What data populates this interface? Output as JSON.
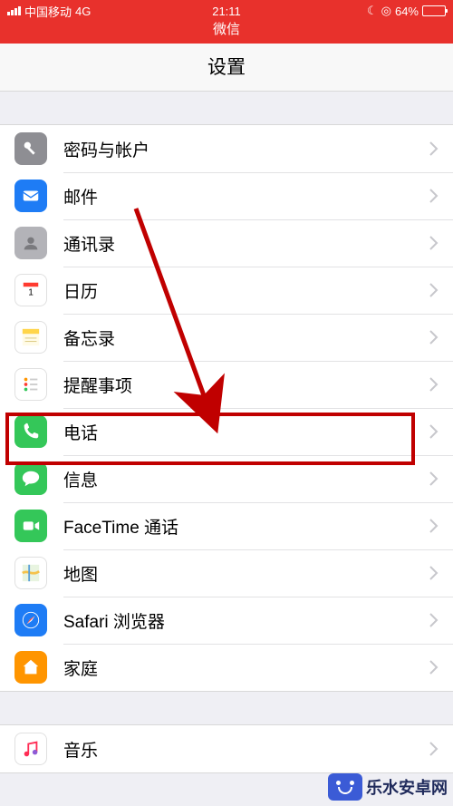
{
  "status": {
    "carrier": "中国移动",
    "network": "4G",
    "time": "21:11",
    "battery": "64%",
    "moon": "☾",
    "alarm": "◎"
  },
  "nav": {
    "subtitle": "微信"
  },
  "page": {
    "title": "设置"
  },
  "group1": [
    {
      "id": "password",
      "label": "密码与帐户"
    },
    {
      "id": "mail",
      "label": "邮件"
    },
    {
      "id": "contacts",
      "label": "通讯录"
    },
    {
      "id": "calendar",
      "label": "日历"
    },
    {
      "id": "notes",
      "label": "备忘录"
    },
    {
      "id": "reminders",
      "label": "提醒事项"
    },
    {
      "id": "phone",
      "label": "电话"
    },
    {
      "id": "messages",
      "label": "信息"
    },
    {
      "id": "facetime",
      "label": "FaceTime 通话"
    },
    {
      "id": "maps",
      "label": "地图"
    },
    {
      "id": "safari",
      "label": "Safari 浏览器"
    },
    {
      "id": "home",
      "label": "家庭"
    }
  ],
  "group2": [
    {
      "id": "music",
      "label": "音乐"
    }
  ],
  "watermark": "乐水安卓网"
}
